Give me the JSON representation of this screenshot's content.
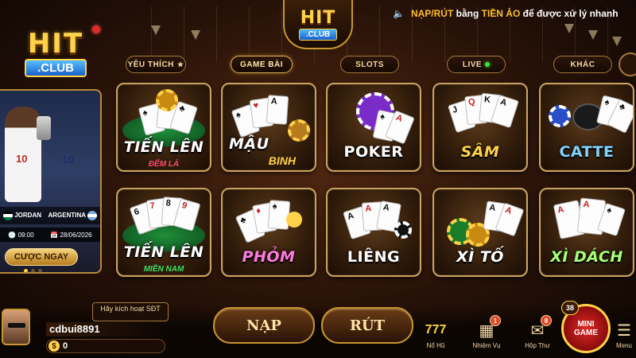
{
  "brand": {
    "hit": "HIT",
    "club": ".CLUB"
  },
  "notice": {
    "prefix": "NẠP/RÚT",
    "mid": " bằng ",
    "highlight": "TIỀN ẢO",
    "suffix": " để được xử lý nhanh"
  },
  "tabs": [
    {
      "label": "YÊU THÍCH",
      "icon": "star-icon"
    },
    {
      "label": "GAME BÀI",
      "active": true
    },
    {
      "label": "SLOTS"
    },
    {
      "label": "LIVE",
      "icon": "live-dot-icon"
    },
    {
      "label": "KHÁC"
    }
  ],
  "promo": {
    "team1": "JORDAN",
    "team2": "ARGENTINA",
    "time": "09:00",
    "date": "28/06/2026",
    "cta": "CƯỢC NGAY"
  },
  "games": [
    {
      "name": "TIẾN LÊN",
      "sub": "ĐẾM LÁ"
    },
    {
      "name": "MẬU",
      "sub2": "BINH"
    },
    {
      "name": "POKER"
    },
    {
      "name": "SÂM"
    },
    {
      "name": "CATTE"
    },
    {
      "name": "TIẾN LÊN",
      "sub": "MIỀN NAM"
    },
    {
      "name": "PHỎM"
    },
    {
      "name": "LIÊNG"
    },
    {
      "name": "XÌ TỐ"
    },
    {
      "name": "XÌ DÁCH"
    }
  ],
  "user": {
    "activate": "Hãy kích hoạt SĐT",
    "username": "cdbui8891",
    "balance": "0"
  },
  "buttons": {
    "deposit": "NẠP",
    "withdraw": "RÚT"
  },
  "bottom_icons": [
    {
      "label": "Nổ Hũ",
      "icon": "jackpot-icon"
    },
    {
      "label": "Nhiệm Vụ",
      "icon": "mission-icon",
      "badge": "1"
    },
    {
      "label": "Hộp Thư",
      "icon": "mail-icon",
      "badge": "8"
    }
  ],
  "mini_game": {
    "label1": "MINI",
    "label2": "GAME",
    "badge": "38"
  },
  "menu_label": "Menu"
}
